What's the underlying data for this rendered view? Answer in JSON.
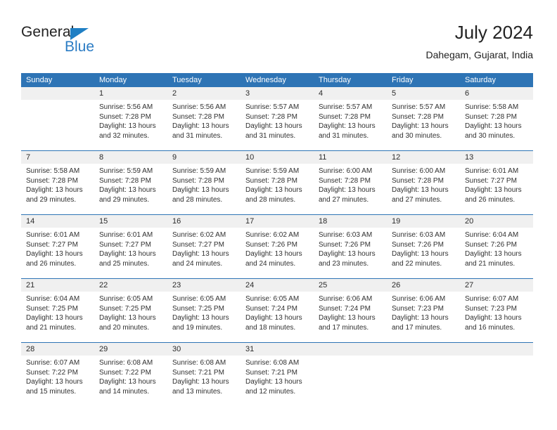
{
  "logo": {
    "word_one": "General",
    "word_two": "Blue",
    "accent_color": "#2b7cc4"
  },
  "header": {
    "title": "July 2024",
    "location": "Dahegam, Gujarat, India",
    "header_bg_color": "#2e74b5",
    "daynumber_bg_color": "#f0f0f0"
  },
  "weekday_names": [
    "Sunday",
    "Monday",
    "Tuesday",
    "Wednesday",
    "Thursday",
    "Friday",
    "Saturday"
  ],
  "weeks": [
    {
      "days": [
        {
          "num": "",
          "sunrise": "",
          "sunset": "",
          "daylight_a": "",
          "daylight_b": ""
        },
        {
          "num": "1",
          "sunrise": "Sunrise: 5:56 AM",
          "sunset": "Sunset: 7:28 PM",
          "daylight_a": "Daylight: 13 hours",
          "daylight_b": "and 32 minutes."
        },
        {
          "num": "2",
          "sunrise": "Sunrise: 5:56 AM",
          "sunset": "Sunset: 7:28 PM",
          "daylight_a": "Daylight: 13 hours",
          "daylight_b": "and 31 minutes."
        },
        {
          "num": "3",
          "sunrise": "Sunrise: 5:57 AM",
          "sunset": "Sunset: 7:28 PM",
          "daylight_a": "Daylight: 13 hours",
          "daylight_b": "and 31 minutes."
        },
        {
          "num": "4",
          "sunrise": "Sunrise: 5:57 AM",
          "sunset": "Sunset: 7:28 PM",
          "daylight_a": "Daylight: 13 hours",
          "daylight_b": "and 31 minutes."
        },
        {
          "num": "5",
          "sunrise": "Sunrise: 5:57 AM",
          "sunset": "Sunset: 7:28 PM",
          "daylight_a": "Daylight: 13 hours",
          "daylight_b": "and 30 minutes."
        },
        {
          "num": "6",
          "sunrise": "Sunrise: 5:58 AM",
          "sunset": "Sunset: 7:28 PM",
          "daylight_a": "Daylight: 13 hours",
          "daylight_b": "and 30 minutes."
        }
      ]
    },
    {
      "days": [
        {
          "num": "7",
          "sunrise": "Sunrise: 5:58 AM",
          "sunset": "Sunset: 7:28 PM",
          "daylight_a": "Daylight: 13 hours",
          "daylight_b": "and 29 minutes."
        },
        {
          "num": "8",
          "sunrise": "Sunrise: 5:59 AM",
          "sunset": "Sunset: 7:28 PM",
          "daylight_a": "Daylight: 13 hours",
          "daylight_b": "and 29 minutes."
        },
        {
          "num": "9",
          "sunrise": "Sunrise: 5:59 AM",
          "sunset": "Sunset: 7:28 PM",
          "daylight_a": "Daylight: 13 hours",
          "daylight_b": "and 28 minutes."
        },
        {
          "num": "10",
          "sunrise": "Sunrise: 5:59 AM",
          "sunset": "Sunset: 7:28 PM",
          "daylight_a": "Daylight: 13 hours",
          "daylight_b": "and 28 minutes."
        },
        {
          "num": "11",
          "sunrise": "Sunrise: 6:00 AM",
          "sunset": "Sunset: 7:28 PM",
          "daylight_a": "Daylight: 13 hours",
          "daylight_b": "and 27 minutes."
        },
        {
          "num": "12",
          "sunrise": "Sunrise: 6:00 AM",
          "sunset": "Sunset: 7:28 PM",
          "daylight_a": "Daylight: 13 hours",
          "daylight_b": "and 27 minutes."
        },
        {
          "num": "13",
          "sunrise": "Sunrise: 6:01 AM",
          "sunset": "Sunset: 7:27 PM",
          "daylight_a": "Daylight: 13 hours",
          "daylight_b": "and 26 minutes."
        }
      ]
    },
    {
      "days": [
        {
          "num": "14",
          "sunrise": "Sunrise: 6:01 AM",
          "sunset": "Sunset: 7:27 PM",
          "daylight_a": "Daylight: 13 hours",
          "daylight_b": "and 26 minutes."
        },
        {
          "num": "15",
          "sunrise": "Sunrise: 6:01 AM",
          "sunset": "Sunset: 7:27 PM",
          "daylight_a": "Daylight: 13 hours",
          "daylight_b": "and 25 minutes."
        },
        {
          "num": "16",
          "sunrise": "Sunrise: 6:02 AM",
          "sunset": "Sunset: 7:27 PM",
          "daylight_a": "Daylight: 13 hours",
          "daylight_b": "and 24 minutes."
        },
        {
          "num": "17",
          "sunrise": "Sunrise: 6:02 AM",
          "sunset": "Sunset: 7:26 PM",
          "daylight_a": "Daylight: 13 hours",
          "daylight_b": "and 24 minutes."
        },
        {
          "num": "18",
          "sunrise": "Sunrise: 6:03 AM",
          "sunset": "Sunset: 7:26 PM",
          "daylight_a": "Daylight: 13 hours",
          "daylight_b": "and 23 minutes."
        },
        {
          "num": "19",
          "sunrise": "Sunrise: 6:03 AM",
          "sunset": "Sunset: 7:26 PM",
          "daylight_a": "Daylight: 13 hours",
          "daylight_b": "and 22 minutes."
        },
        {
          "num": "20",
          "sunrise": "Sunrise: 6:04 AM",
          "sunset": "Sunset: 7:26 PM",
          "daylight_a": "Daylight: 13 hours",
          "daylight_b": "and 21 minutes."
        }
      ]
    },
    {
      "days": [
        {
          "num": "21",
          "sunrise": "Sunrise: 6:04 AM",
          "sunset": "Sunset: 7:25 PM",
          "daylight_a": "Daylight: 13 hours",
          "daylight_b": "and 21 minutes."
        },
        {
          "num": "22",
          "sunrise": "Sunrise: 6:05 AM",
          "sunset": "Sunset: 7:25 PM",
          "daylight_a": "Daylight: 13 hours",
          "daylight_b": "and 20 minutes."
        },
        {
          "num": "23",
          "sunrise": "Sunrise: 6:05 AM",
          "sunset": "Sunset: 7:25 PM",
          "daylight_a": "Daylight: 13 hours",
          "daylight_b": "and 19 minutes."
        },
        {
          "num": "24",
          "sunrise": "Sunrise: 6:05 AM",
          "sunset": "Sunset: 7:24 PM",
          "daylight_a": "Daylight: 13 hours",
          "daylight_b": "and 18 minutes."
        },
        {
          "num": "25",
          "sunrise": "Sunrise: 6:06 AM",
          "sunset": "Sunset: 7:24 PM",
          "daylight_a": "Daylight: 13 hours",
          "daylight_b": "and 17 minutes."
        },
        {
          "num": "26",
          "sunrise": "Sunrise: 6:06 AM",
          "sunset": "Sunset: 7:23 PM",
          "daylight_a": "Daylight: 13 hours",
          "daylight_b": "and 17 minutes."
        },
        {
          "num": "27",
          "sunrise": "Sunrise: 6:07 AM",
          "sunset": "Sunset: 7:23 PM",
          "daylight_a": "Daylight: 13 hours",
          "daylight_b": "and 16 minutes."
        }
      ]
    },
    {
      "days": [
        {
          "num": "28",
          "sunrise": "Sunrise: 6:07 AM",
          "sunset": "Sunset: 7:22 PM",
          "daylight_a": "Daylight: 13 hours",
          "daylight_b": "and 15 minutes."
        },
        {
          "num": "29",
          "sunrise": "Sunrise: 6:08 AM",
          "sunset": "Sunset: 7:22 PM",
          "daylight_a": "Daylight: 13 hours",
          "daylight_b": "and 14 minutes."
        },
        {
          "num": "30",
          "sunrise": "Sunrise: 6:08 AM",
          "sunset": "Sunset: 7:21 PM",
          "daylight_a": "Daylight: 13 hours",
          "daylight_b": "and 13 minutes."
        },
        {
          "num": "31",
          "sunrise": "Sunrise: 6:08 AM",
          "sunset": "Sunset: 7:21 PM",
          "daylight_a": "Daylight: 13 hours",
          "daylight_b": "and 12 minutes."
        },
        {
          "num": "",
          "sunrise": "",
          "sunset": "",
          "daylight_a": "",
          "daylight_b": ""
        },
        {
          "num": "",
          "sunrise": "",
          "sunset": "",
          "daylight_a": "",
          "daylight_b": ""
        },
        {
          "num": "",
          "sunrise": "",
          "sunset": "",
          "daylight_a": "",
          "daylight_b": ""
        }
      ]
    }
  ]
}
